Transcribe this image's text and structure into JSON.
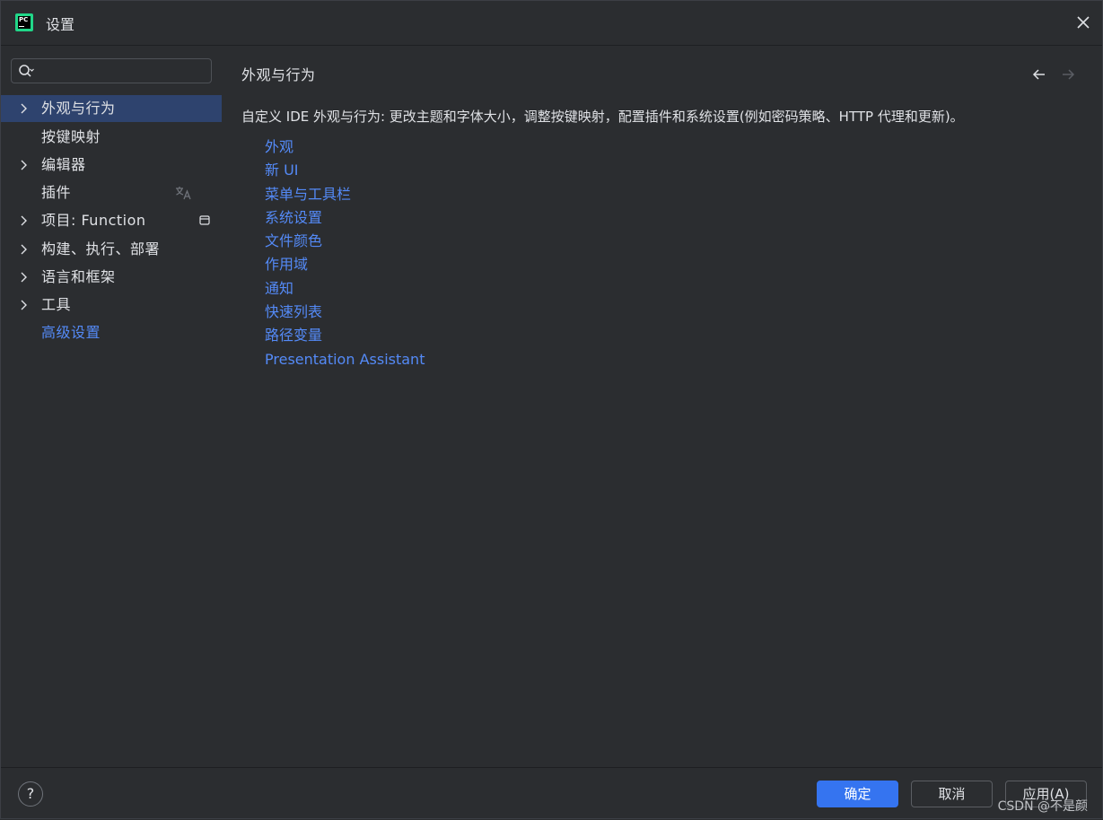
{
  "window": {
    "title": "设置",
    "app_icon_text": "PC"
  },
  "search": {
    "placeholder": "",
    "value": ""
  },
  "sidebar": {
    "items": [
      {
        "label": "外观与行为",
        "expandable": true,
        "selected": true
      },
      {
        "label": "按键映射",
        "expandable": false
      },
      {
        "label": "编辑器",
        "expandable": true
      },
      {
        "label": "插件",
        "expandable": false,
        "trailing_icon": "translate-icon"
      },
      {
        "label": "项目: Function",
        "expandable": true,
        "trailing_icon": "window-icon"
      },
      {
        "label": "构建、执行、部署",
        "expandable": true
      },
      {
        "label": "语言和框架",
        "expandable": true
      },
      {
        "label": "工具",
        "expandable": true
      },
      {
        "label": "高级设置",
        "expandable": false,
        "highlighted": true
      }
    ]
  },
  "content": {
    "title": "外观与行为",
    "description": "自定义 IDE 外观与行为: 更改主题和字体大小，调整按键映射，配置插件和系统设置(例如密码策略、HTTP 代理和更新)。",
    "links": [
      "外观",
      "新 UI",
      "菜单与工具栏",
      "系统设置",
      "文件颜色",
      "作用域",
      "通知",
      "快速列表",
      "路径变量",
      "Presentation Assistant"
    ]
  },
  "footer": {
    "help_label": "?",
    "ok_label": "确定",
    "cancel_label": "取消",
    "apply_label": "应用(A)",
    "watermark": "CSDN @不是颜"
  },
  "colors": {
    "background": "#2b2d30",
    "selection": "#2e436e",
    "link": "#548af7",
    "primary_button": "#3574f0"
  }
}
